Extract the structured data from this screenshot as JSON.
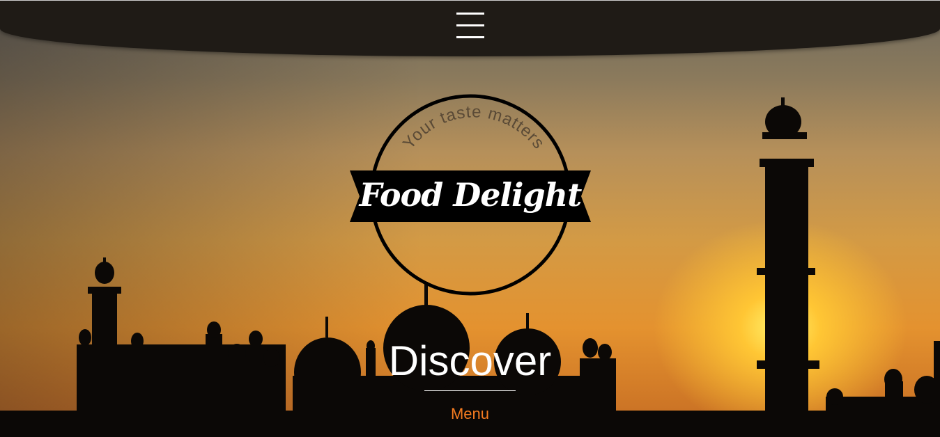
{
  "header": {
    "menu_icon": "hamburger-icon"
  },
  "logo": {
    "tagline": "Your taste matters",
    "brand": "Food Delight"
  },
  "hero": {
    "headline": "Discover",
    "cta_label": "Menu"
  },
  "colors": {
    "accent": "#f47b20",
    "header_bg": "#1f1b16",
    "sky_glow": "#ffc634"
  }
}
